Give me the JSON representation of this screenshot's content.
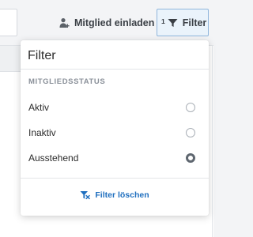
{
  "toolbar": {
    "invite_label": "Mitglied einladen",
    "filter_count": "1",
    "filter_label": "Filter"
  },
  "filter_panel": {
    "title": "Filter",
    "section_label": "MITGLIEDSSTATUS",
    "options": [
      {
        "label": "Aktiv",
        "selected": false
      },
      {
        "label": "Inaktiv",
        "selected": false
      },
      {
        "label": "Ausstehend",
        "selected": true
      }
    ],
    "clear_label": "Filter löschen"
  },
  "icons": {
    "invite": "add-person-icon",
    "filter": "funnel-icon",
    "clear": "funnel-clear-icon"
  },
  "colors": {
    "accent": "#1f6fbf",
    "filter_active_bg": "#eaf3fb",
    "filter_active_border": "#8fb6dc"
  }
}
